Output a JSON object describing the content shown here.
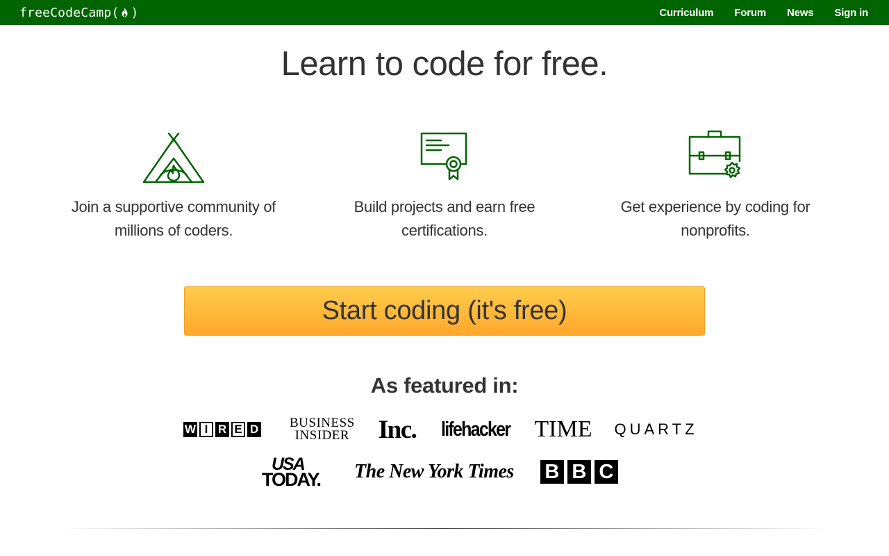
{
  "navbar": {
    "brand_prefix": "freeCodeCamp(",
    "brand_suffix": ")",
    "brand_icon": "flame-icon",
    "links": [
      {
        "label": "Curriculum"
      },
      {
        "label": "Forum"
      },
      {
        "label": "News"
      },
      {
        "label": "Sign in"
      }
    ],
    "colors": {
      "background": "#006400",
      "text": "#ffffff"
    }
  },
  "hero": {
    "title": "Learn to code for free."
  },
  "features": [
    {
      "icon": "campfire-tent-icon",
      "text": "Join a supportive community of millions of coders."
    },
    {
      "icon": "certificate-icon",
      "text": "Build projects and earn free certifications."
    },
    {
      "icon": "briefcase-icon",
      "text": "Get experience by coding for nonprofits."
    }
  ],
  "cta": {
    "label": "Start coding (it's free)",
    "colors": {
      "top": "#fecc4c",
      "bottom": "#ffa82b"
    }
  },
  "featured": {
    "title": "As featured in:",
    "logos_row1": [
      "WIRED",
      "BUSINESS INSIDER",
      "Inc.",
      "lifehacker",
      "TIME",
      "QUARTZ"
    ],
    "logos_row2": [
      "USA TODAY",
      "The New York Times",
      "BBC"
    ],
    "business_insider": {
      "line1": "BUSINESS",
      "line2": "INSIDER"
    },
    "usa_today": {
      "line1": "USA",
      "line2": "TODAY."
    }
  },
  "accent_color": "#006400"
}
